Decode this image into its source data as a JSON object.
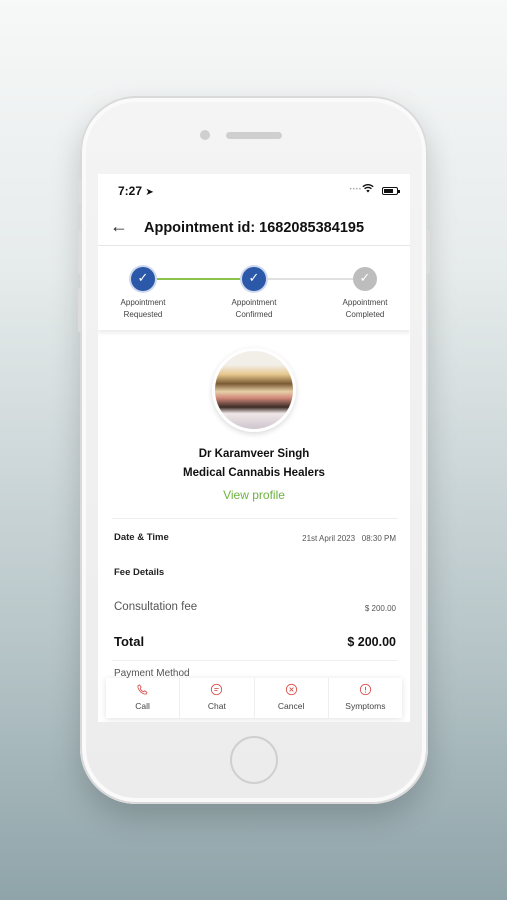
{
  "status_bar": {
    "time": "7:27"
  },
  "header": {
    "title": "Appointment id: 1682085384195"
  },
  "stepper": {
    "steps": [
      {
        "label_line1": "Appointment",
        "label_line2": "Requested",
        "state": "done"
      },
      {
        "label_line1": "Appointment",
        "label_line2": "Confirmed",
        "state": "done"
      },
      {
        "label_line1": "Appointment",
        "label_line2": "Completed",
        "state": "pending"
      }
    ],
    "colors": {
      "done": "#2b58a8",
      "pending": "#bdbdbd",
      "progress_line": "#8bc34a",
      "pending_line": "#e0e0e0"
    }
  },
  "doctor": {
    "name": "Dr Karamveer Singh",
    "clinic": "Medical Cannabis Healers",
    "view_profile_label": "View profile"
  },
  "details": {
    "date_time_label": "Date & Time",
    "date_time_value": "21st April 2023   08:30 PM",
    "fee_details_label": "Fee Details",
    "consultation_fee_label": "Consultation fee",
    "consultation_fee_value": "$ 200.00",
    "total_label": "Total",
    "total_value": "$ 200.00",
    "payment_method_label": "Payment Method"
  },
  "actions": [
    {
      "label": "Call",
      "icon": "phone-icon"
    },
    {
      "label": "Chat",
      "icon": "chat-icon"
    },
    {
      "label": "Cancel",
      "icon": "cancel-icon"
    },
    {
      "label": "Symptoms",
      "icon": "info-icon"
    }
  ],
  "accent_color": "#d9534f",
  "link_color": "#6db33f"
}
